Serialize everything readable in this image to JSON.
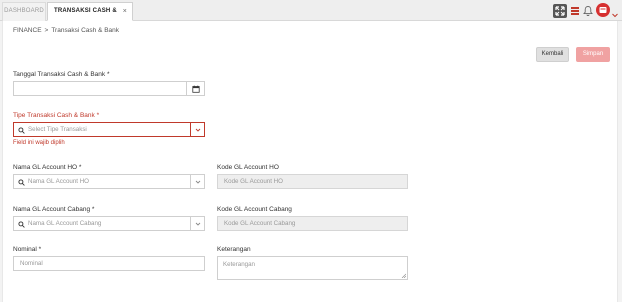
{
  "tabs": [
    {
      "label": "DASHBOARD"
    },
    {
      "label": "TRANSAKSI CASH & BANK",
      "close": "×"
    }
  ],
  "breadcrumb": {
    "parent": "FINANCE",
    "separator": ">",
    "current": "Transaksi Cash & Bank"
  },
  "actions": {
    "back_label": "Kembali",
    "save_label": "Simpan"
  },
  "form": {
    "tanggal": {
      "label": "Tanggal Transaksi Cash & Bank *",
      "value": ""
    },
    "tipe": {
      "label": "Tipe Transaksi Cash & Bank *",
      "placeholder": "Select Tipe Transaksi",
      "error": "Field ini wajib diplih"
    },
    "gl_ho": {
      "label": "Nama GL Account HO *",
      "placeholder": "Nama GL Account HO"
    },
    "kode_ho": {
      "label": "Kode GL Account HO",
      "placeholder": "Kode GL Account HO"
    },
    "gl_cabang": {
      "label": "Nama GL Account Cabang *",
      "placeholder": "Nama GL Account Cabang"
    },
    "kode_cabang": {
      "label": "Kode GL Account Cabang",
      "placeholder": "Kode GL Account Cabang"
    },
    "nominal": {
      "label": "Nominal *",
      "placeholder": "Nominal"
    },
    "keterangan": {
      "label": "Keterangan",
      "placeholder": "Keterangan"
    }
  },
  "colors": {
    "accent": "#c0392b",
    "save_disabled": "#f0a2a2"
  },
  "icons": [
    "expand-icon",
    "menu-icon",
    "bell-icon",
    "avatar-icon",
    "chevron-down-icon",
    "calendar-icon",
    "search-icon"
  ]
}
